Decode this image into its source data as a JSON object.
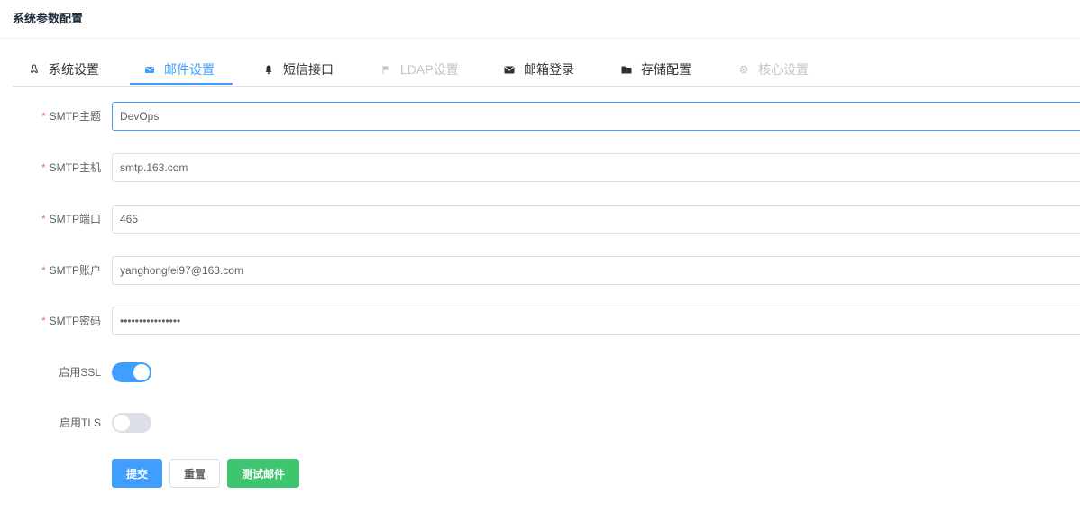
{
  "page": {
    "title": "系统参数配置"
  },
  "tabs": [
    {
      "label": "系统设置",
      "icon": "linux-icon",
      "state": "normal"
    },
    {
      "label": "邮件设置",
      "icon": "mail-icon",
      "state": "active"
    },
    {
      "label": "短信接口",
      "icon": "bell-icon",
      "state": "normal"
    },
    {
      "label": "LDAP设置",
      "icon": "flag-icon",
      "state": "disabled"
    },
    {
      "label": "邮箱登录",
      "icon": "envelope-icon",
      "state": "normal"
    },
    {
      "label": "存储配置",
      "icon": "folder-icon",
      "state": "normal"
    },
    {
      "label": "核心设置",
      "icon": "gear-icon",
      "state": "disabled"
    }
  ],
  "form": {
    "required_mark": "*",
    "smtp_subject": {
      "label": "SMTP主题",
      "value": "DevOps"
    },
    "smtp_host": {
      "label": "SMTP主机",
      "value": "smtp.163.com"
    },
    "smtp_port": {
      "label": "SMTP端口",
      "value": "465"
    },
    "smtp_account": {
      "label": "SMTP账户",
      "value": "yanghongfei97@163.com"
    },
    "smtp_password": {
      "label": "SMTP密码",
      "value": "••••••••••••••••"
    },
    "enable_ssl": {
      "label": "启用SSL",
      "on": true
    },
    "enable_tls": {
      "label": "启用TLS",
      "on": false
    }
  },
  "buttons": {
    "submit": "提交",
    "reset": "重置",
    "test_mail": "测试邮件"
  },
  "colors": {
    "primary": "#409eff",
    "success": "#3ec66e",
    "required": "#f56c6c",
    "disabled": "#c0c4cc"
  }
}
